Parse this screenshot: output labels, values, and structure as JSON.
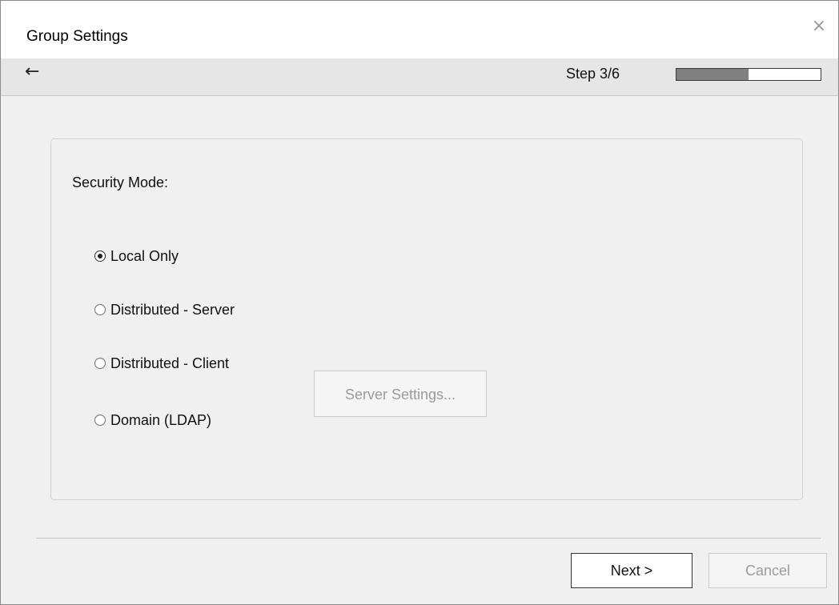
{
  "window": {
    "title": "Group Settings",
    "close_glyph": "×"
  },
  "nav": {
    "back_glyph": "←",
    "step_label": "Step 3/6",
    "progress_fraction": 0.5
  },
  "security": {
    "label": "Security Mode:",
    "options": [
      {
        "label": "Local Only",
        "checked": true
      },
      {
        "label": "Distributed - Server",
        "checked": false
      },
      {
        "label": "Distributed - Client",
        "checked": false
      },
      {
        "label": "Domain (LDAP)",
        "checked": false
      }
    ],
    "server_settings_label": "Server Settings...",
    "server_settings_enabled": false
  },
  "footer": {
    "next_label": "Next >",
    "cancel_label": "Cancel",
    "cancel_enabled": false
  }
}
